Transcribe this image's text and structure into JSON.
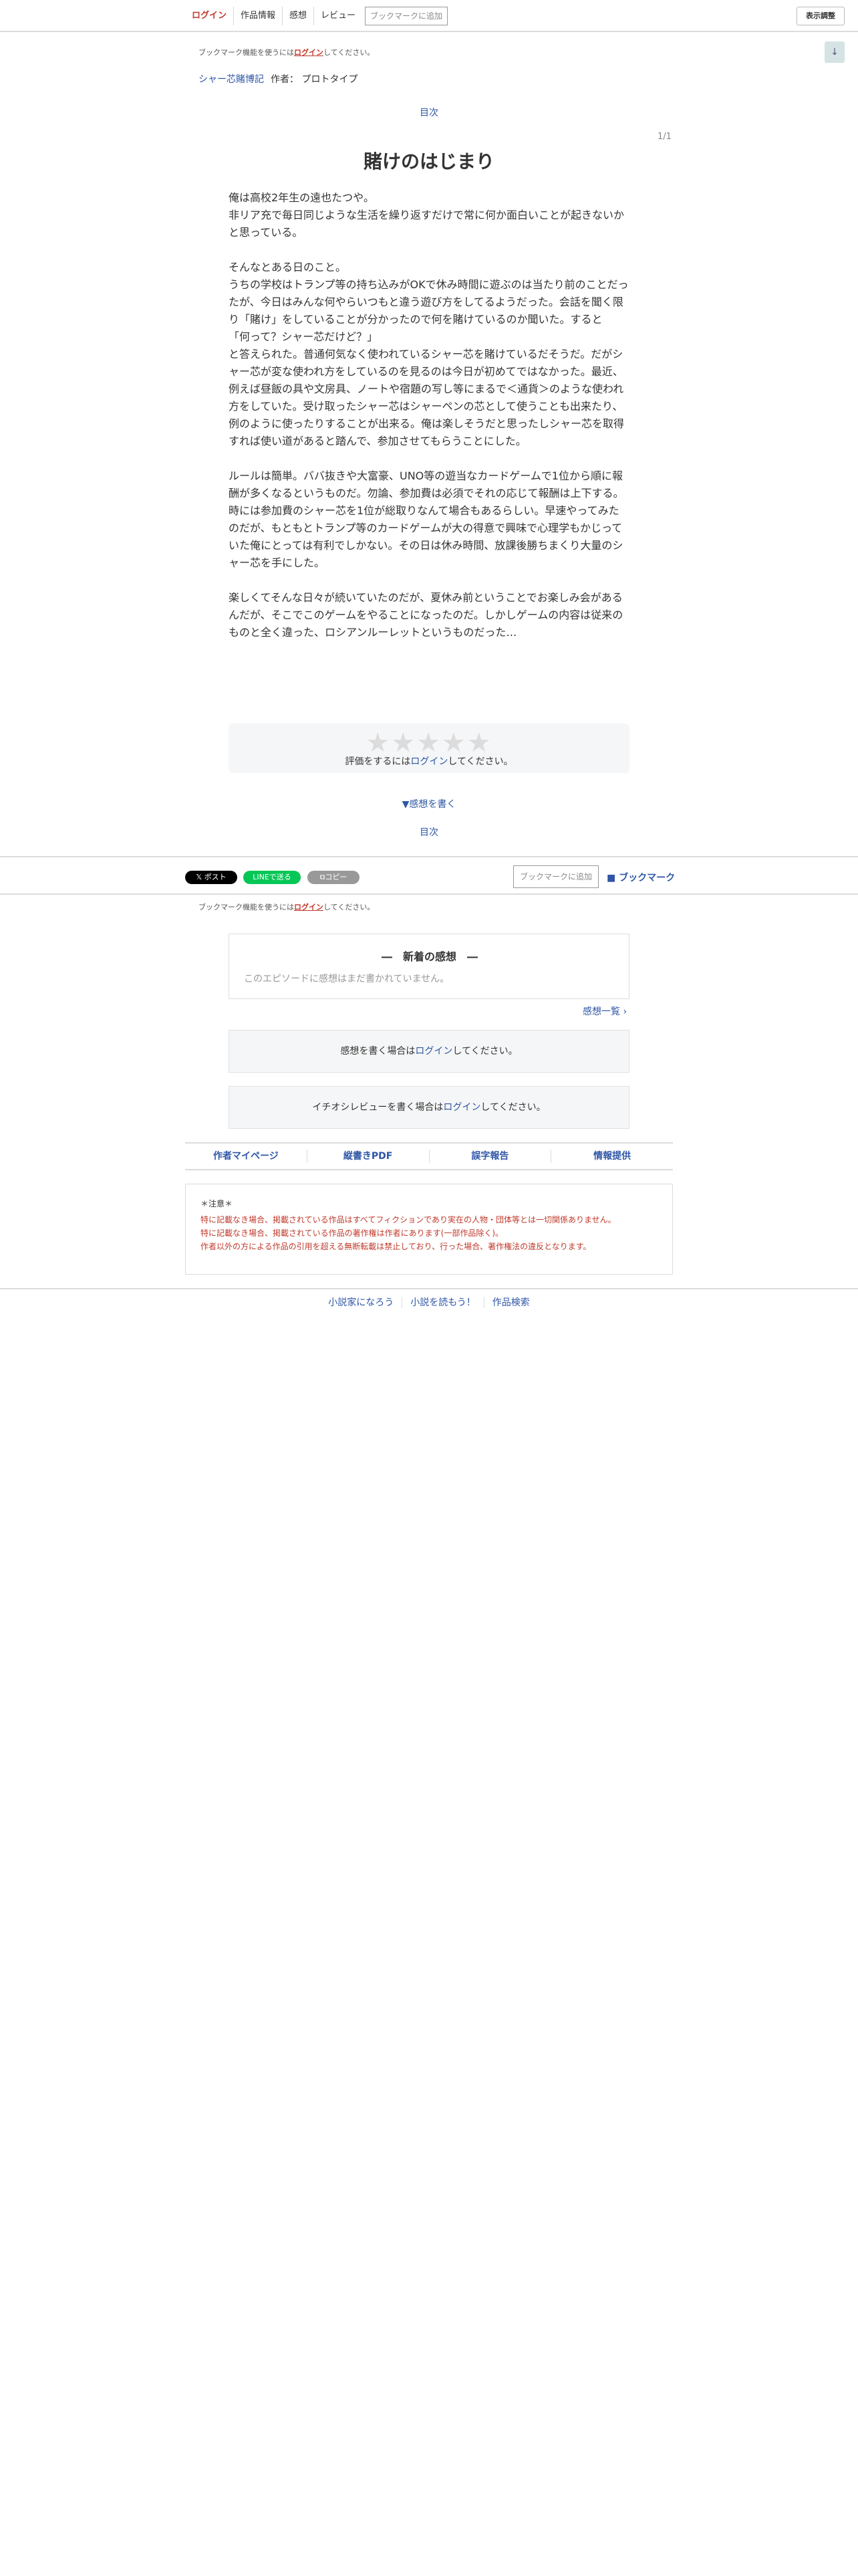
{
  "nav": {
    "login": "ログイン",
    "work_info": "作品情報",
    "impressions": "感想",
    "review": "レビュー",
    "add_bookmark": "ブックマークに追加",
    "display_settings": "表示調整",
    "scroll_icon": "↓"
  },
  "bookmark_note": {
    "prefix": "ブックマーク機能を使うには",
    "login": "ログイン",
    "suffix": "してください。"
  },
  "series": {
    "name": "シャー芯賭博記",
    "author_label": "作者：",
    "author": "プロトタイプ"
  },
  "toc_label": "目次",
  "page_count": "1/1",
  "episode": {
    "title": "賭けのはじまり",
    "paragraphs": [
      "俺は高校2年生の遠也たつや。\n非リア充で毎日同じような生活を繰り返すだけで常に何か面白いことが起きないかと思っている。",
      "そんなとある日のこと。\nうちの学校はトランプ等の持ち込みがOKで休み時間に遊ぶのは当たり前のことだったが、今日はみんな何やらいつもと違う遊び方をしてるようだった。会話を聞く限り「賭け」をしていることが分かったので何を賭けているのか聞いた。すると\n「何って？シャー芯だけど？」\nと答えられた。普通何気なく使われているシャー芯を賭けているだそうだ。だがシャー芯が変な使われ方をしているのを見るのは今日が初めてではなかった。最近、例えば昼飯の具や文房具、ノートや宿題の写し等にまるで＜通貨＞のような使われ方をしていた。受け取ったシャー芯はシャーペンの芯として使うことも出来たり、例のように使ったりすることが出来る。俺は楽しそうだと思ったしシャー芯を取得すれば使い道があると踏んで、参加させてもらうことにした。",
      "ルールは簡単。ババ抜きや大富豪、UNO等の遊当なカードゲームで1位から順に報酬が多くなるというものだ。勿論、参加費は必須でそれの応じて報酬は上下する。時には参加費のシャー芯を1位が総取りなんて場合もあるらしい。早速やってみたのだが、もともとトランプ等のカードゲームが大の得意で興味で心理学もかじっていた俺にとっては有利でしかない。その日は休み時間、放課後勝ちまくり大量のシャー芯を手にした。",
      "楽しくてそんな日々が続いていたのだが、夏休み前ということでお楽しみ会があるんだが、そこでこのゲームをやることになったのだ。しかしゲームの内容は従来のものと全く違った、ロシアンルーレットというものだった…"
    ]
  },
  "rating": {
    "stars": "★★★★★",
    "prefix": "評価をするには",
    "login": "ログイン",
    "suffix": "してください。"
  },
  "write_impression": "▼感想を書く",
  "share": {
    "post": "𝕏 ポスト",
    "line": "LINEで送る",
    "copy": "⧉コピー",
    "add_bookmark": "ブックマークに追加",
    "bookmark": "■ ブックマーク"
  },
  "latest_impressions": {
    "title": "―　新着の感想　―",
    "empty": "このエピソードに感想はまだ書かれていません。",
    "list_link": "感想一覧 ›"
  },
  "impression_login": {
    "prefix": "感想を書く場合は",
    "login": "ログイン",
    "suffix": "してください。"
  },
  "review_login": {
    "prefix": "イチオシレビューを書く場合は",
    "login": "ログイン",
    "suffix": "してください。"
  },
  "footer_links": [
    "作者マイページ",
    "縦書きPDF",
    "誤字報告",
    "情報提供"
  ],
  "notice": {
    "head": "＊注意＊",
    "lines": [
      "特に記載なき場合、掲載されている作品はすべてフィクションであり実在の人物・団体等とは一切関係ありません。",
      "特に記載なき場合、掲載されている作品の著作権は作者にあります(一部作品除く)。",
      "作者以外の方による作品の引用を超える無断転載は禁止しており、行った場合、著作権法の違反となります。"
    ]
  },
  "bottom_links": [
    "小説家になろう",
    "小説を読もう！",
    "作品検索"
  ]
}
